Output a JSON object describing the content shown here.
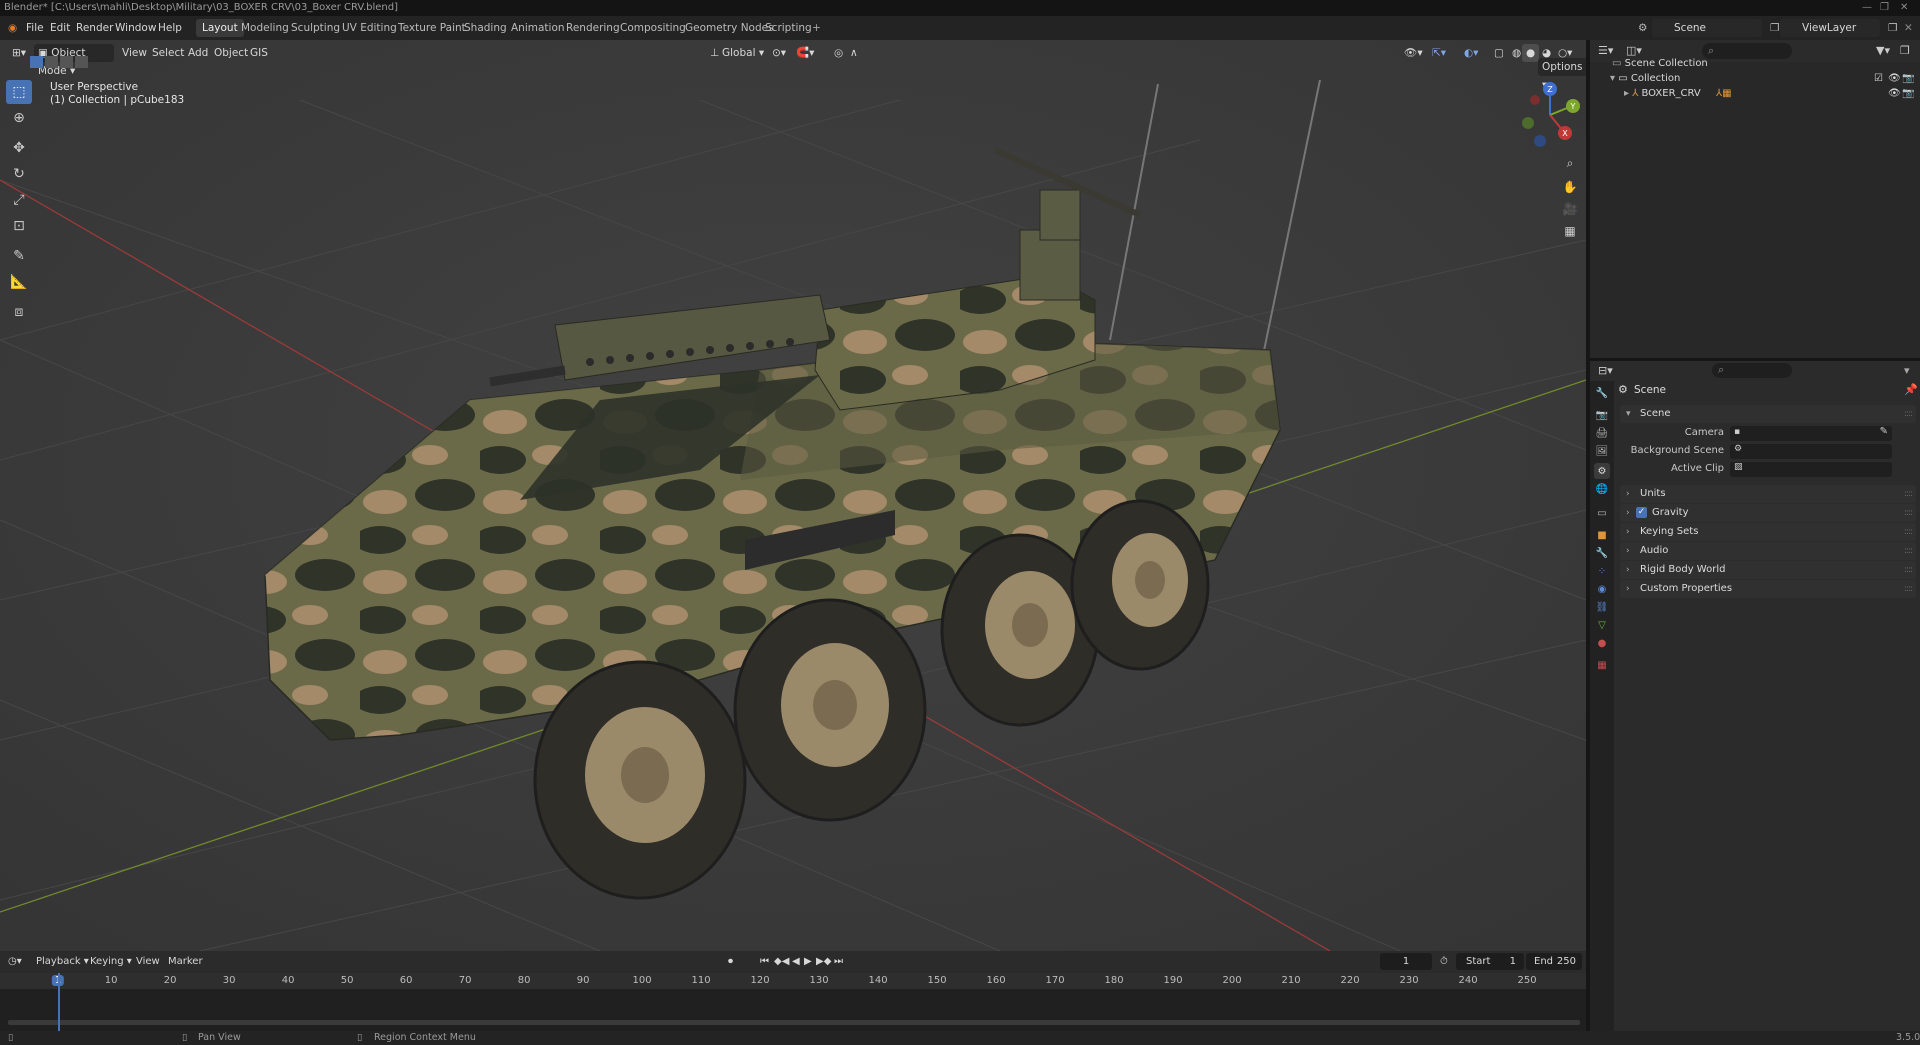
{
  "window": {
    "title": "Blender* [C:\\Users\\mahli\\Desktop\\Military\\03_BOXER CRV\\03_Boxer CRV.blend]"
  },
  "menubar": {
    "items": [
      "File",
      "Edit",
      "Render",
      "Window",
      "Help"
    ]
  },
  "workspaces": [
    "Layout",
    "Modeling",
    "Sculpting",
    "UV Editing",
    "Texture Paint",
    "Shading",
    "Animation",
    "Rendering",
    "Compositing",
    "Geometry Nodes",
    "Scripting"
  ],
  "active_workspace": "Layout",
  "scene_selector": {
    "scene": "Scene",
    "view_layer": "ViewLayer"
  },
  "viewport": {
    "mode": "Object Mode",
    "menus": [
      "View",
      "Select",
      "Add",
      "Object",
      "GIS"
    ],
    "orientation": "Global",
    "options_label": "Options",
    "overlay_title": "User Perspective",
    "overlay_subtitle": "(1) Collection | pCube183",
    "gizmo_axes": {
      "x": "X",
      "y": "Y",
      "z": "Z"
    }
  },
  "timeline": {
    "menus": [
      "Playback",
      "Keying",
      "View",
      "Marker"
    ],
    "current_frame": "1",
    "start_label": "Start",
    "start_value": "1",
    "end_label": "End",
    "end_value": "250",
    "ticks": [
      "1",
      "10",
      "20",
      "30",
      "40",
      "50",
      "60",
      "70",
      "80",
      "90",
      "100",
      "110",
      "120",
      "130",
      "140",
      "150",
      "160",
      "170",
      "180",
      "190",
      "200",
      "210",
      "220",
      "230",
      "240",
      "250"
    ]
  },
  "statusbar": {
    "hint1": "Pan View",
    "hint2": "Region Context Menu",
    "version": "3.5.0"
  },
  "outliner": {
    "rows": [
      {
        "label": "Scene Collection",
        "indent": 0
      },
      {
        "label": "Collection",
        "indent": 1
      },
      {
        "label": "BOXER_CRV",
        "indent": 2
      }
    ]
  },
  "properties": {
    "breadcrumb": "Scene",
    "panel_scene": "Scene",
    "camera_label": "Camera",
    "background_scene_label": "Background Scene",
    "active_clip_label": "Active Clip",
    "panels": [
      "Units",
      "Gravity",
      "Keying Sets",
      "Audio",
      "Rigid Body World",
      "Custom Properties"
    ],
    "gravity_checked": true
  },
  "colors": {
    "accent": "#4772b3",
    "viewport_bg": "#3d3d3d",
    "axis_red": "#c23838",
    "axis_green": "#7da62e",
    "gizmo_blue": "#3f6fd1"
  }
}
